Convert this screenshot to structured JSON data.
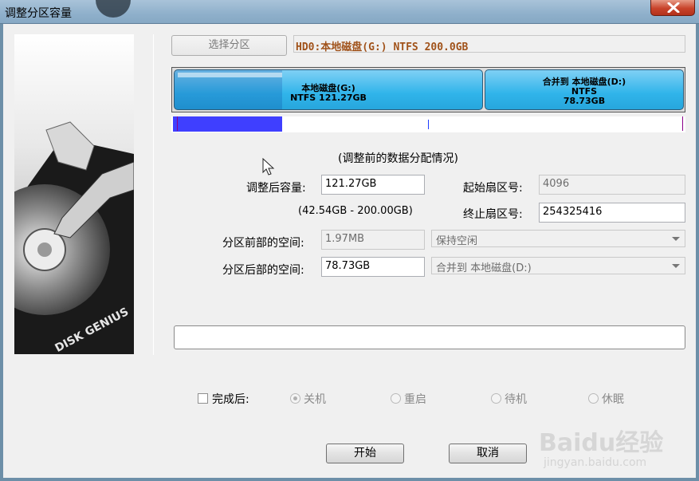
{
  "window": {
    "title": "调整分区容量",
    "close_icon": "close-icon"
  },
  "toolbar": {
    "select_partition_label": "选择分区"
  },
  "disk_info": "HD0:本地磁盘(G:) NTFS 200.0GB",
  "partition_bar": {
    "left": {
      "name": "本地磁盘(G:)",
      "detail": "NTFS 121.27GB",
      "used_fraction": 0.35
    },
    "right": {
      "name": "合并到 本地磁盘(D:)",
      "fs": "NTFS",
      "size": "78.73GB"
    }
  },
  "slider": {
    "fill_fraction": 0.212
  },
  "caption": "(调整前的数据分配情况)",
  "form": {
    "new_size_label": "调整后容量:",
    "new_size_value": "121.27GB",
    "range_text": "(42.54GB - 200.00GB)",
    "start_sector_label": "起始扇区号:",
    "start_sector_value": "4096",
    "end_sector_label": "终止扇区号:",
    "end_sector_value": "254325416",
    "before_space_label": "分区前部的空间:",
    "before_space_value": "1.97MB",
    "before_space_action": "保持空闲",
    "after_space_label": "分区后部的空间:",
    "after_space_value": "78.73GB",
    "after_space_action": "合并到 本地磁盘(D:)"
  },
  "completion": {
    "checkbox_label": "完成后:",
    "options": [
      "关机",
      "重启",
      "待机",
      "休眠"
    ],
    "selected": "关机"
  },
  "buttons": {
    "start": "开始",
    "cancel": "取消"
  },
  "watermark": {
    "logo": "Baidu经验",
    "url": "jingyan.baidu.com"
  }
}
